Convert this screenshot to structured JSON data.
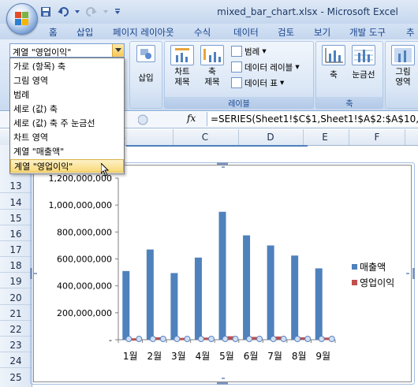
{
  "window": {
    "title": "mixed_bar_chart.xlsx - Microsoft Excel"
  },
  "ribbon_tabs": [
    "홈",
    "삽입",
    "페이지 레이아웃",
    "수식",
    "데이터",
    "검토",
    "보기",
    "개발 도구",
    "추"
  ],
  "ribbon": {
    "insert_label": "삽입",
    "chart_title_label": [
      "차트",
      "제목"
    ],
    "axis_title_label": [
      "축",
      "제목"
    ],
    "legend_label": "범례",
    "data_labels_label": "데이터 레이블",
    "data_table_label": "데이터 표",
    "labels_group": "레이블",
    "axes_label": "축",
    "gridlines_label": "눈금선",
    "axes_group": "축",
    "plot_area_label": [
      "그림",
      "영역"
    ]
  },
  "chart_element_select": {
    "value": "계열 \"영업이익\"",
    "options": [
      "가로 (항목) 축",
      "그림 영역",
      "범례",
      "세로 (값) 축",
      "세로 (값) 축 주 눈금선",
      "차트 영역",
      "계열 \"매출액\"",
      "계열 \"영업이익\""
    ],
    "selected_index": 7
  },
  "formula_bar": {
    "fx": "fx",
    "formula": "=SERIES(Sheet1!$C$1,Sheet1!$A$2:$A$10,S"
  },
  "columns": [
    "B",
    "C",
    "D",
    "E",
    "F"
  ],
  "rows": [
    "13",
    "14",
    "15",
    "16",
    "17",
    "18",
    "19",
    "20",
    "21",
    "22",
    "23",
    "24",
    "25"
  ],
  "colors": {
    "series1": "#4f81bd",
    "series2": "#c0504d",
    "accent": "#15428b"
  },
  "chart_data": {
    "type": "bar",
    "categories": [
      "1월",
      "2월",
      "3월",
      "4월",
      "5월",
      "6월",
      "7월",
      "8월",
      "9월"
    ],
    "series": [
      {
        "name": "매출액",
        "values": [
          510000000,
          670000000,
          495000000,
          610000000,
          950000000,
          775000000,
          700000000,
          625000000,
          530000000
        ]
      },
      {
        "name": "영업이익",
        "values": [
          5000000,
          12000000,
          8000000,
          10000000,
          20000000,
          15000000,
          18000000,
          12000000,
          10000000
        ]
      }
    ],
    "yticks": [
      "-",
      "200,000,000",
      "400,000,000",
      "600,000,000",
      "800,000,000",
      "1,000,000,000",
      "1,200,000,000"
    ],
    "ylim": [
      0,
      1200000000
    ],
    "legend": "right",
    "grid": false
  }
}
